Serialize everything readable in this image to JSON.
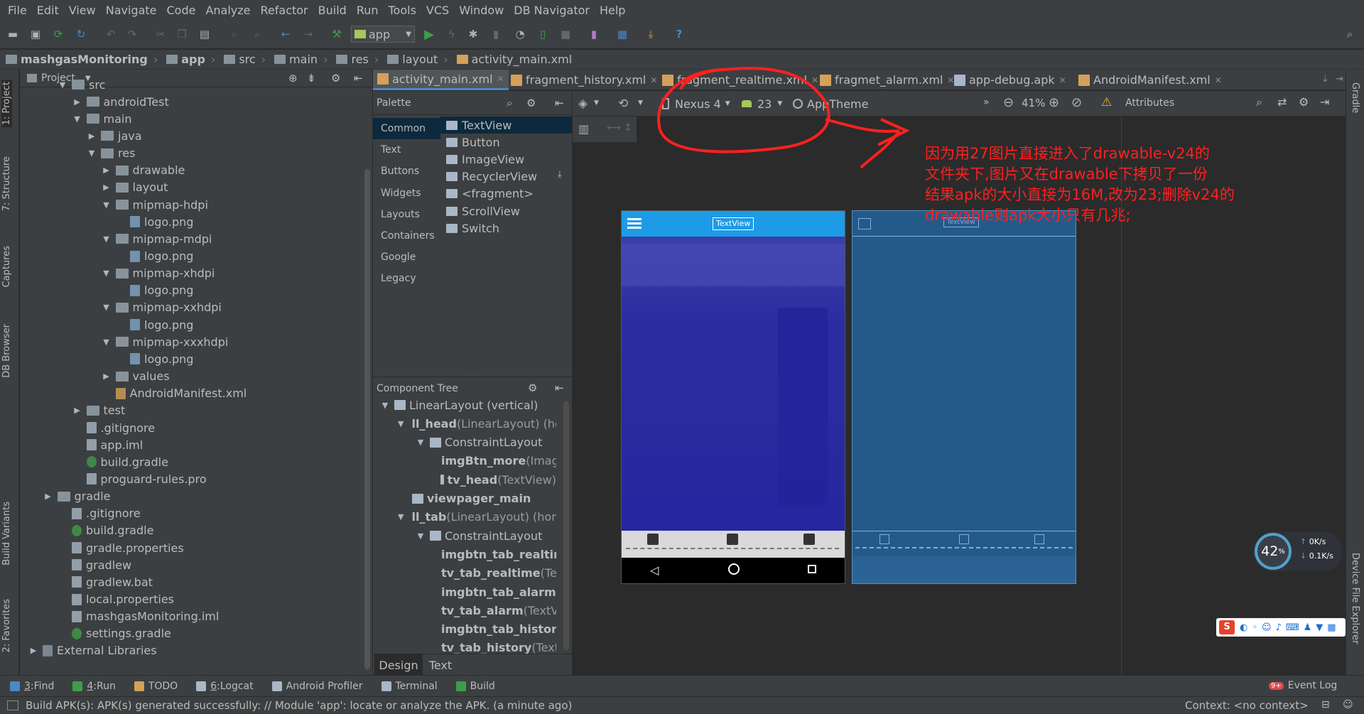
{
  "menu": [
    "File",
    "Edit",
    "View",
    "Navigate",
    "Code",
    "Analyze",
    "Refactor",
    "Build",
    "Run",
    "Tools",
    "VCS",
    "Window",
    "DB Navigator",
    "Help"
  ],
  "toolbar": {
    "run_config": "app"
  },
  "breadcrumb": [
    "mashgasMonitoring",
    "app",
    "src",
    "main",
    "res",
    "layout",
    "activity_main.xml"
  ],
  "left_tabs": [
    "1: Project",
    "7: Structure",
    "Captures",
    "DB Browser",
    "Build Variants",
    "2: Favorites"
  ],
  "right_tabs": [
    "Gradle",
    "Device File Explorer"
  ],
  "project": {
    "header": "Project",
    "tree": [
      {
        "label": "src",
        "depth": 2,
        "open": true,
        "icon": "folder-icon"
      },
      {
        "label": "androidTest",
        "depth": 3,
        "open": false,
        "icon": "folder-icon"
      },
      {
        "label": "main",
        "depth": 3,
        "open": true,
        "icon": "folder-icon"
      },
      {
        "label": "java",
        "depth": 4,
        "open": false,
        "icon": "folder-icon"
      },
      {
        "label": "res",
        "depth": 4,
        "open": true,
        "icon": "folder-icon"
      },
      {
        "label": "drawable",
        "depth": 5,
        "open": false,
        "icon": "folder-icon"
      },
      {
        "label": "layout",
        "depth": 5,
        "open": false,
        "icon": "folder-icon"
      },
      {
        "label": "mipmap-hdpi",
        "depth": 5,
        "open": true,
        "icon": "folder-icon"
      },
      {
        "label": "logo.png",
        "depth": 6,
        "icon": "png-icon"
      },
      {
        "label": "mipmap-mdpi",
        "depth": 5,
        "open": true,
        "icon": "folder-icon"
      },
      {
        "label": "logo.png",
        "depth": 6,
        "icon": "png-icon"
      },
      {
        "label": "mipmap-xhdpi",
        "depth": 5,
        "open": true,
        "icon": "folder-icon"
      },
      {
        "label": "logo.png",
        "depth": 6,
        "icon": "png-icon"
      },
      {
        "label": "mipmap-xxhdpi",
        "depth": 5,
        "open": true,
        "icon": "folder-icon"
      },
      {
        "label": "logo.png",
        "depth": 6,
        "icon": "png-icon"
      },
      {
        "label": "mipmap-xxxhdpi",
        "depth": 5,
        "open": true,
        "icon": "folder-icon"
      },
      {
        "label": "logo.png",
        "depth": 6,
        "icon": "png-icon"
      },
      {
        "label": "values",
        "depth": 5,
        "open": false,
        "icon": "folder-icon"
      },
      {
        "label": "AndroidManifest.xml",
        "depth": 5,
        "icon": "xml-icon"
      },
      {
        "label": "test",
        "depth": 3,
        "open": false,
        "icon": "folder-icon"
      },
      {
        "label": ".gitignore",
        "depth": 3,
        "icon": "file-icon"
      },
      {
        "label": "app.iml",
        "depth": 3,
        "icon": "file-icon"
      },
      {
        "label": "build.gradle",
        "depth": 3,
        "icon": "gradle-icon"
      },
      {
        "label": "proguard-rules.pro",
        "depth": 3,
        "icon": "file-icon"
      },
      {
        "label": "gradle",
        "depth": 1,
        "open": false,
        "icon": "folder-icon"
      },
      {
        "label": ".gitignore",
        "depth": 2,
        "icon": "file-icon"
      },
      {
        "label": "build.gradle",
        "depth": 2,
        "icon": "gradle-icon"
      },
      {
        "label": "gradle.properties",
        "depth": 2,
        "icon": "file-icon"
      },
      {
        "label": "gradlew",
        "depth": 2,
        "icon": "file-icon"
      },
      {
        "label": "gradlew.bat",
        "depth": 2,
        "icon": "file-icon"
      },
      {
        "label": "local.properties",
        "depth": 2,
        "icon": "file-icon"
      },
      {
        "label": "mashgasMonitoring.iml",
        "depth": 2,
        "icon": "file-icon"
      },
      {
        "label": "settings.gradle",
        "depth": 2,
        "icon": "gradle-icon"
      },
      {
        "label": "External Libraries",
        "depth": 0,
        "open": false,
        "icon": "library-icon"
      }
    ]
  },
  "editor_tabs": [
    "activity_main.xml",
    "fragment_history.xml",
    "fragment_realtime.xml",
    "fragmet_alarm.xml",
    "app-debug.apk",
    "AndroidManifest.xml"
  ],
  "palette": {
    "title": "Palette",
    "categories": [
      "Common",
      "Text",
      "Buttons",
      "Widgets",
      "Layouts",
      "Containers",
      "Google",
      "Legacy"
    ],
    "components": [
      "TextView",
      "Button",
      "ImageView",
      "RecyclerView",
      "<fragment>",
      "ScrollView",
      "Switch"
    ]
  },
  "component_tree": {
    "title": "Component Tree",
    "rows": [
      {
        "depth": 0,
        "bold": "",
        "name": "LinearLayout (vertical)"
      },
      {
        "depth": 1,
        "bold": "ll_head",
        "name": " (LinearLayout) (hor"
      },
      {
        "depth": 2,
        "bold": "",
        "name": "ConstraintLayout"
      },
      {
        "depth": 3,
        "bold": "imgBtn_more",
        "name": " (Imag"
      },
      {
        "depth": 3,
        "bold": "tv_head",
        "name": " (TextView)"
      },
      {
        "depth": 1,
        "bold": "viewpager_main",
        "name": ""
      },
      {
        "depth": 1,
        "bold": "ll_tab",
        "name": " (LinearLayout) (horiz"
      },
      {
        "depth": 2,
        "bold": "",
        "name": "ConstraintLayout"
      },
      {
        "depth": 3,
        "bold": "imgbtn_tab_realtim",
        "name": ""
      },
      {
        "depth": 3,
        "bold": "tv_tab_realtime",
        "name": " (Te"
      },
      {
        "depth": 3,
        "bold": "imgbtn_tab_alarm",
        "name": " ("
      },
      {
        "depth": 3,
        "bold": "tv_tab_alarm",
        "name": " (TextV"
      },
      {
        "depth": 3,
        "bold": "imgbtn_tab_history",
        "name": ""
      },
      {
        "depth": 3,
        "bold": "tv_tab_history",
        "name": " (Text"
      }
    ]
  },
  "design_tabs": [
    "Design",
    "Text"
  ],
  "canvas_toolbar": {
    "device": "Nexus 4",
    "api": "23",
    "theme": "AppTheme",
    "zoom": "41%",
    "attributes": "Attributes"
  },
  "preview": {
    "header_text": "TextView",
    "blueprint_text": "TextView"
  },
  "annotation": [
    "因为用27图片直接进入了drawable-v24的",
    "文件夹下,图片又在drawable下拷贝了一份",
    "结果apk的大小直接为16M,改为23;删除v24的",
    "drawable则apk大小只有几兆;"
  ],
  "netmon": {
    "percent": "42",
    "unit": "%",
    "up": "0K/s",
    "down": "0.1K/s"
  },
  "bottom_tools": [
    {
      "key": "3",
      "label": "Find"
    },
    {
      "key": "4",
      "label": "Run"
    },
    {
      "key": "",
      "label": "TODO"
    },
    {
      "key": "6",
      "label": "Logcat"
    },
    {
      "key": "",
      "label": "Android Profiler"
    },
    {
      "key": "",
      "label": "Terminal"
    },
    {
      "key": "",
      "label": "Build"
    }
  ],
  "event_log": {
    "badge": "9+",
    "label": "Event Log"
  },
  "status": {
    "message": "Build APK(s): APK(s) generated successfully: // Module 'app': locate or analyze the APK. (a minute ago)",
    "context": "Context: <no context>"
  },
  "colors": {
    "bg": "#2b2b2b",
    "panel": "#3c3f41",
    "selection": "#0d293e",
    "accent": "#4a88c7",
    "annotation": "#ff2020",
    "phone_header": "#1d9be6",
    "blueprint": "#245a8a"
  }
}
